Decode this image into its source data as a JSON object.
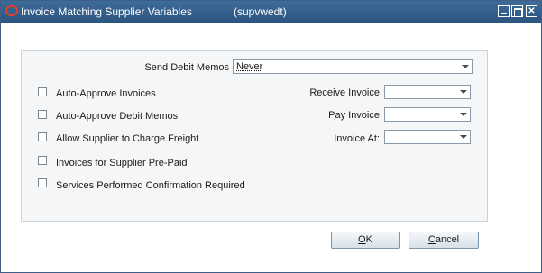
{
  "window": {
    "title": "Invoice Matching Supplier Variables",
    "subtitle": "(supvwedt)",
    "controls": {
      "minimize": "minimize",
      "maximize": "maximize",
      "close": "✕"
    }
  },
  "form": {
    "send_debit_memos": {
      "label": "Send Debit Memos",
      "value": "Never"
    },
    "checkboxes": [
      {
        "label": "Auto-Approve Invoices",
        "checked": false
      },
      {
        "label": "Auto-Approve Debit Memos",
        "checked": false
      },
      {
        "label": "Allow Supplier to Charge Freight",
        "checked": false
      },
      {
        "label": "Invoices for Supplier Pre-Paid",
        "checked": false
      },
      {
        "label": "Services Performed Confirmation Required",
        "checked": false
      }
    ],
    "receive_invoice": {
      "label": "Receive Invoice",
      "value": ""
    },
    "pay_invoice": {
      "label": "Pay Invoice",
      "value": ""
    },
    "invoice_at": {
      "label": "Invoice At:",
      "value": ""
    }
  },
  "buttons": {
    "ok": {
      "mnemonic": "O",
      "rest": "K"
    },
    "cancel": {
      "mnemonic": "C",
      "rest": "ancel"
    }
  },
  "icons": {
    "app": "oracle-o-icon",
    "dropdown": "chevron-down-icon"
  },
  "colors": {
    "titlebar": "#2f5a86",
    "panel_bg": "#f4f6f8",
    "app_icon": "#e0402a"
  }
}
